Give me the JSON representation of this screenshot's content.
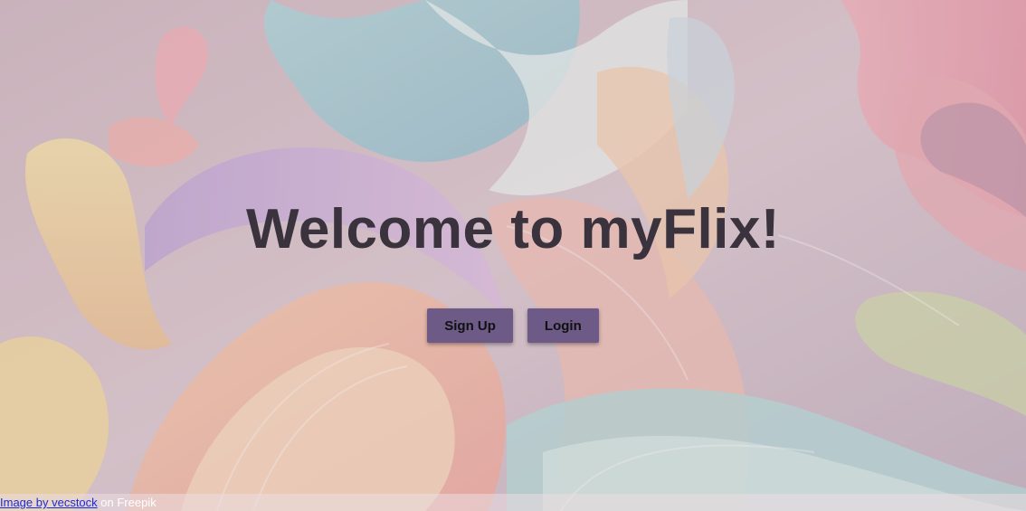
{
  "colors": {
    "page_background": "#cbb8be",
    "title_text": "#3a333d",
    "button_background": "#6d5a87",
    "button_text": "#111111",
    "link": "#1a2bd8"
  },
  "background": {
    "icon": "pastel-abstract-swirl-artwork"
  },
  "hero": {
    "title": "Welcome to myFlix!"
  },
  "actions": {
    "signup_label": "Sign Up",
    "login_label": "Login"
  },
  "credit": {
    "link_text": "Image by vecstock",
    "suffix": " on Freepik"
  }
}
